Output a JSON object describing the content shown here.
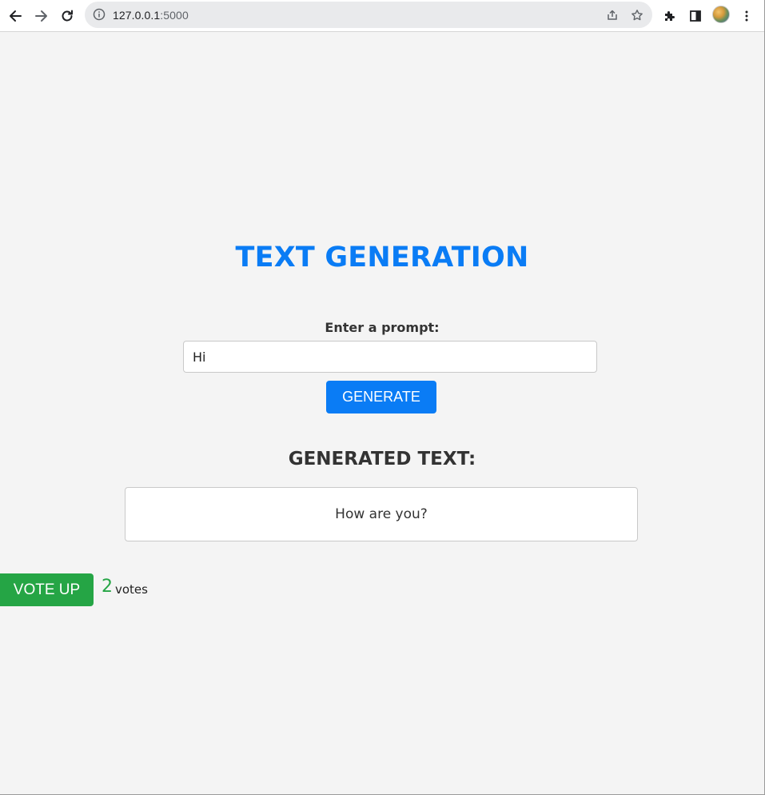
{
  "browser": {
    "url_host": "127.0.0.1",
    "url_port": ":5000",
    "icons": {
      "back": "arrow-left-icon",
      "forward": "arrow-right-icon",
      "reload": "reload-icon",
      "site_info": "info-icon",
      "share": "share-icon",
      "bookmark": "star-icon",
      "extensions": "puzzle-icon",
      "side_panel": "side-panel-icon",
      "profile": "avatar",
      "menu": "kebab-menu-icon"
    }
  },
  "page": {
    "title": "TEXT GENERATION",
    "prompt_label": "Enter a prompt:",
    "prompt_value": "Hi",
    "generate_label": "GENERATE",
    "generated_heading": "GENERATED TEXT:",
    "generated_text": "How are you?",
    "vote_button_label": "VOTE UP",
    "vote_count": "2",
    "vote_unit": "votes"
  },
  "colors": {
    "accent_blue": "#0a7cf5",
    "vote_green": "#25a545",
    "page_background": "#f4f4f4",
    "heading_text": "#333333"
  }
}
